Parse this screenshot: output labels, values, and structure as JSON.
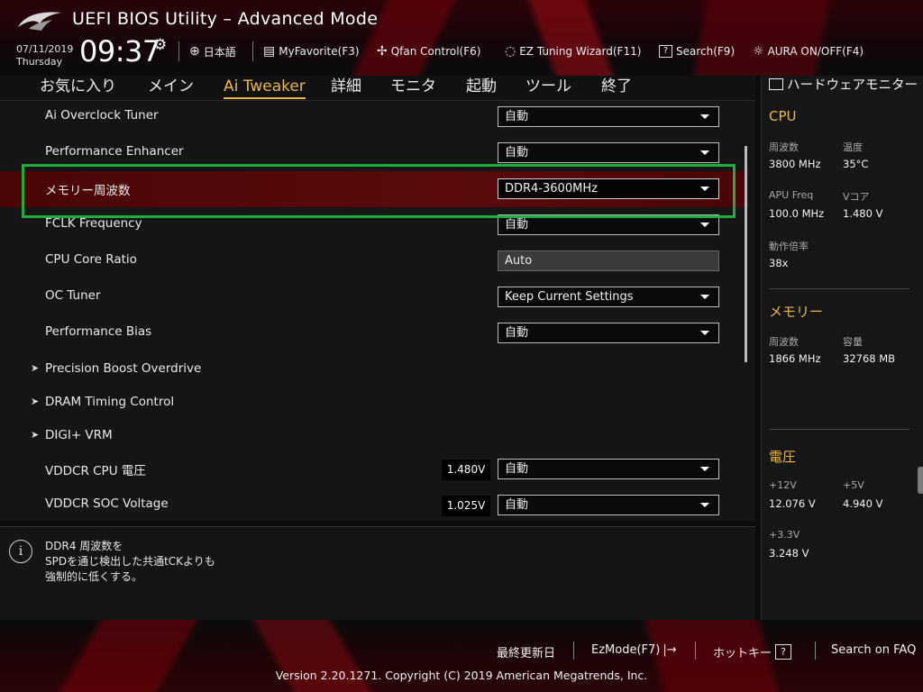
{
  "header": {
    "title": "UEFI BIOS Utility – Advanced Mode",
    "date": "07/11/2019",
    "weekday": "Thursday",
    "time": "09:37",
    "items": {
      "language": "日本語",
      "myfavorite": "MyFavorite(F3)",
      "qfan": "Qfan Control(F6)",
      "ez_tuning": "EZ Tuning Wizard(F11)",
      "search": "Search(F9)",
      "aura": "AURA ON/OFF(F4)"
    }
  },
  "tabs": [
    "お気に入り",
    "メイン",
    "Ai Tweaker",
    "詳細",
    "モニタ",
    "起動",
    "ツール",
    "終了"
  ],
  "active_tab": "Ai Tweaker",
  "settings": [
    {
      "label": "Ai Overclock Tuner",
      "value": "自動"
    },
    {
      "label": "Performance Enhancer",
      "value": "自動"
    },
    {
      "label": "メモリー周波数",
      "value": "DDR4-3600MHz"
    },
    {
      "label": "FCLK Frequency",
      "value": "自動"
    },
    {
      "label": "CPU Core Ratio",
      "value": "Auto"
    },
    {
      "label": "OC Tuner",
      "value": "Keep Current Settings"
    },
    {
      "label": "Performance Bias",
      "value": "自動"
    },
    {
      "label": "Precision Boost Overdrive"
    },
    {
      "label": "DRAM Timing Control"
    },
    {
      "label": "DIGI+ VRM"
    },
    {
      "label": "VDDCR CPU 電圧",
      "voltage": "1.480V",
      "value": "自動"
    },
    {
      "label": "VDDCR SOC Voltage",
      "voltage": "1.025V",
      "value": "自動"
    }
  ],
  "info": {
    "lines": [
      "DDR4 周波数を",
      "SPDを通じ検出した共通tCKよりも",
      "強制的に低くする。"
    ]
  },
  "monitor": {
    "title": "ハードウェアモニター",
    "cpu": {
      "heading": "CPU",
      "freq_label": "周波数",
      "freq_value": "3800 MHz",
      "temp_label": "温度",
      "temp_value": "35°C",
      "apu_label": "APU Freq",
      "apu_value": "100.0 MHz",
      "vcore_label": "Vコア",
      "vcore_value": "1.480 V",
      "ratio_label": "動作倍率",
      "ratio_value": "38x"
    },
    "memory": {
      "heading": "メモリー",
      "freq_label": "周波数",
      "freq_value": "1866 MHz",
      "cap_label": "容量",
      "cap_value": "32768 MB"
    },
    "voltage": {
      "heading": "電圧",
      "v12_label": "+12V",
      "v12_value": "12.076 V",
      "v5_label": "+5V",
      "v5_value": "4.940 V",
      "v33_label": "+3.3V",
      "v33_value": "3.248 V"
    }
  },
  "footer": {
    "last_modified": "最終更新日",
    "ezmode": "EzMode(F7)",
    "hotkeys": "ホットキー",
    "faq": "Search on FAQ",
    "copyright": "Version 2.20.1271. Copyright (C) 2019 American Megatrends, Inc."
  },
  "colors": {
    "accent": "#e8b84b",
    "highlight_row": "#5a0a0c",
    "selection_box": "#1fae3e"
  }
}
